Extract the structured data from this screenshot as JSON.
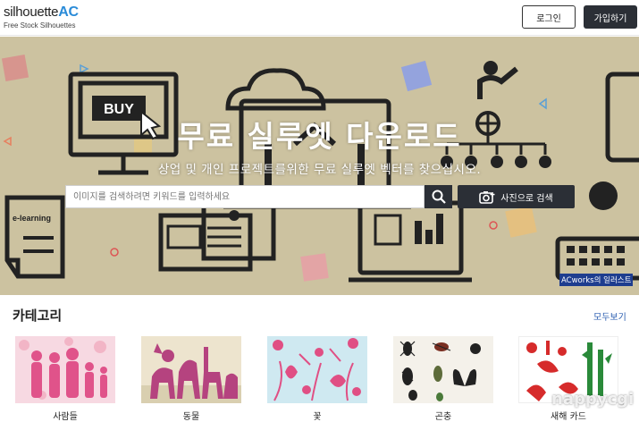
{
  "header": {
    "logo_main": "silhouette",
    "logo_ac": "AC",
    "logo_sub": "Free Stock Silhouettes",
    "login_label": "로그인",
    "signup_label": "가입하기"
  },
  "hero": {
    "title": "무료 실루엣 다운로드",
    "subtitle": "상업 및 개인 프로젝트를위한 무료 실루엣 벡터를 찾으십시오.",
    "search_placeholder": "이미지를 검색하려면 키워드를 입력하세요",
    "photo_search_label": "사진으로 검색",
    "illustration_buy": "BUY",
    "illustration_elearning": "e-learning",
    "credit": "ACworks의 일러스트"
  },
  "categories": {
    "title": "카테고리",
    "view_all": "모두보기",
    "items": [
      {
        "label": "사람들"
      },
      {
        "label": "동물"
      },
      {
        "label": "꽃"
      },
      {
        "label": "곤충"
      },
      {
        "label": "새해 카드"
      }
    ]
  },
  "watermark": "nappycgi",
  "colors": {
    "hero_bg": "#ccc2a0",
    "dark_button": "#2b2f36",
    "brand_blue": "#2a8bd8",
    "link_blue": "#2a5db0"
  }
}
